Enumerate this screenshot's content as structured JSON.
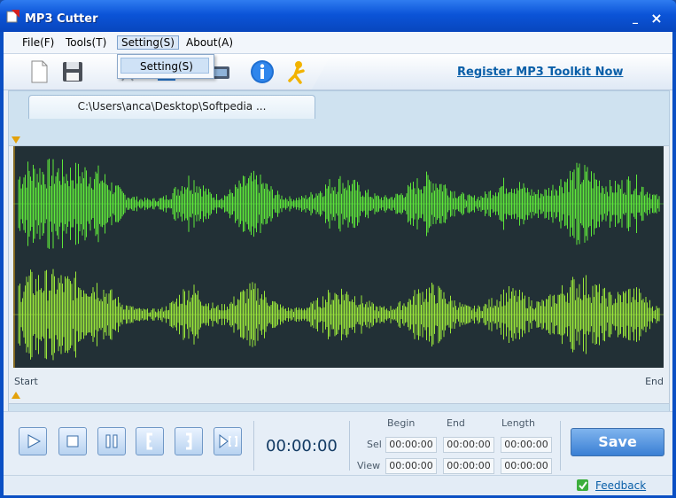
{
  "window": {
    "title": "MP3 Cutter",
    "minimize": "_",
    "close": "×"
  },
  "menu": {
    "file": "File(F)",
    "tools": "Tools(T)",
    "setting": "Setting(S)",
    "about": "About(A)"
  },
  "dropdown": {
    "setting_item": "Setting(S)"
  },
  "toolbar": {
    "icons": [
      "new-file-icon",
      "save-icon",
      "info-icon",
      "aim-icon"
    ],
    "register_link": "Register MP3 Toolkit Now"
  },
  "file_tab": "C:\\Users\\anca\\Desktop\\Softpedia ...",
  "waveform": {
    "start_label": "Start",
    "end_label": "End",
    "wave_color_top": "#5ee83a",
    "wave_color_bottom": "#9be83a",
    "background": "#223036"
  },
  "controls": {
    "buttons": [
      "play-icon",
      "stop-icon",
      "pause-icon",
      "set-start-icon",
      "set-end-icon",
      "play-selection-icon"
    ],
    "time": "00:00:00",
    "columns": {
      "begin": "Begin",
      "end": "End",
      "length": "Length"
    },
    "rows": {
      "sel": {
        "label": "Sel",
        "begin": "00:00:00",
        "end": "00:00:00",
        "length": "00:00:00"
      },
      "view": {
        "label": "View",
        "begin": "00:00:00",
        "end": "00:00:00",
        "length": "00:00:00"
      }
    },
    "save": "Save"
  },
  "status": {
    "feedback": "Feedback"
  }
}
